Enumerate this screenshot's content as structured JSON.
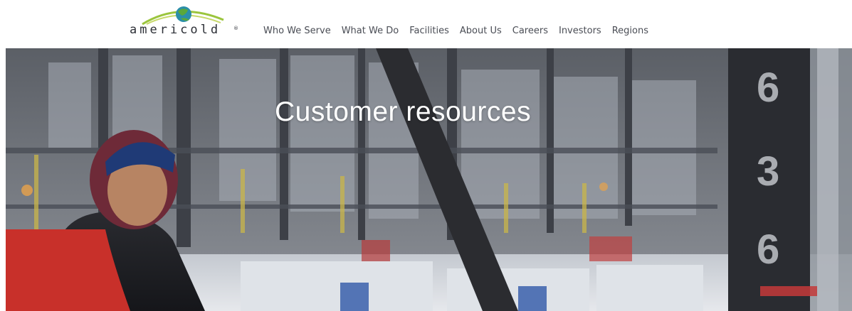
{
  "logo": {
    "wordmark": "americold",
    "registered": "®"
  },
  "nav": {
    "items": [
      {
        "label": "Who We Serve"
      },
      {
        "label": "What We Do"
      },
      {
        "label": "Facilities"
      },
      {
        "label": "About Us"
      },
      {
        "label": "Careers"
      },
      {
        "label": "Investors"
      },
      {
        "label": "Regions"
      }
    ]
  },
  "hero": {
    "title": "Customer resources",
    "rack_numbers": [
      "6",
      "3",
      "6"
    ]
  },
  "colors": {
    "nav_text": "#4a4d55",
    "logo_green": "#5aa83a",
    "logo_teal": "#2b8fa8",
    "hero_title": "#ffffff"
  }
}
